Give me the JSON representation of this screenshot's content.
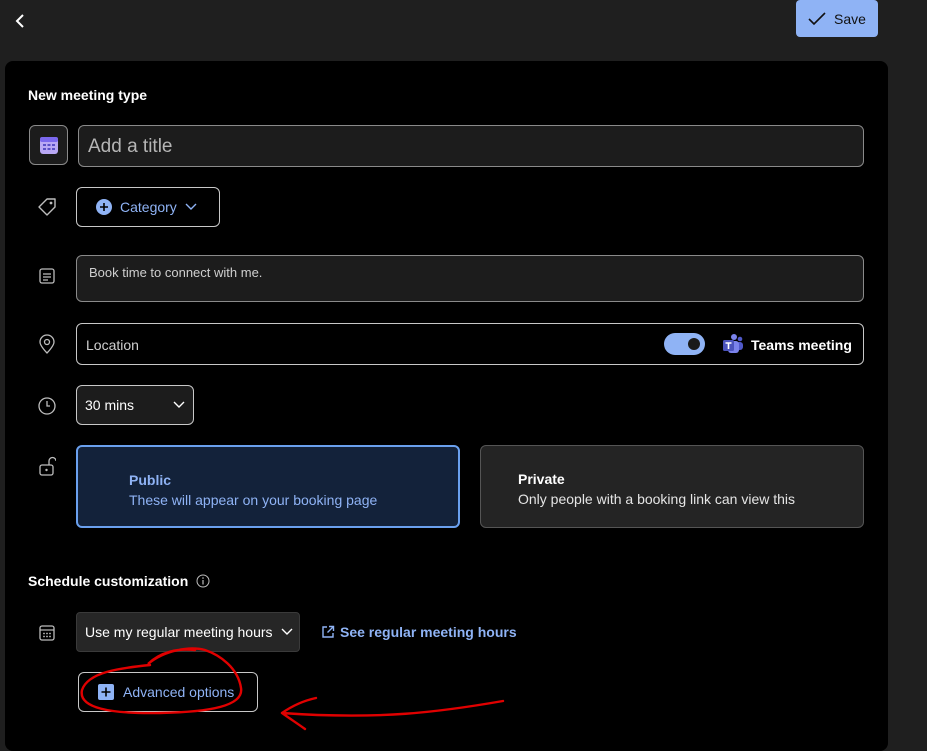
{
  "header": {
    "save_label": "Save"
  },
  "form": {
    "heading": "New meeting type",
    "title_placeholder": "Add a title",
    "category_label": "Category",
    "description_value": "Book time to connect with me.",
    "location_label": "Location",
    "teams_toggle_on": true,
    "teams_label": "Teams meeting",
    "duration_value": "30 mins",
    "visibility": {
      "public_title": "Public",
      "public_desc": "These will appear on your booking page",
      "private_title": "Private",
      "private_desc": "Only people with a booking link can view this",
      "selected": "Public"
    }
  },
  "schedule": {
    "heading": "Schedule customization",
    "hours_value": "Use my regular meeting hours",
    "see_hours_link": "See regular meeting hours",
    "advanced_label": "Advanced options"
  },
  "colors": {
    "accent": "#8fb3f5",
    "annotation": "#e00000",
    "panel": "#000000",
    "page": "#1f1f1f"
  }
}
